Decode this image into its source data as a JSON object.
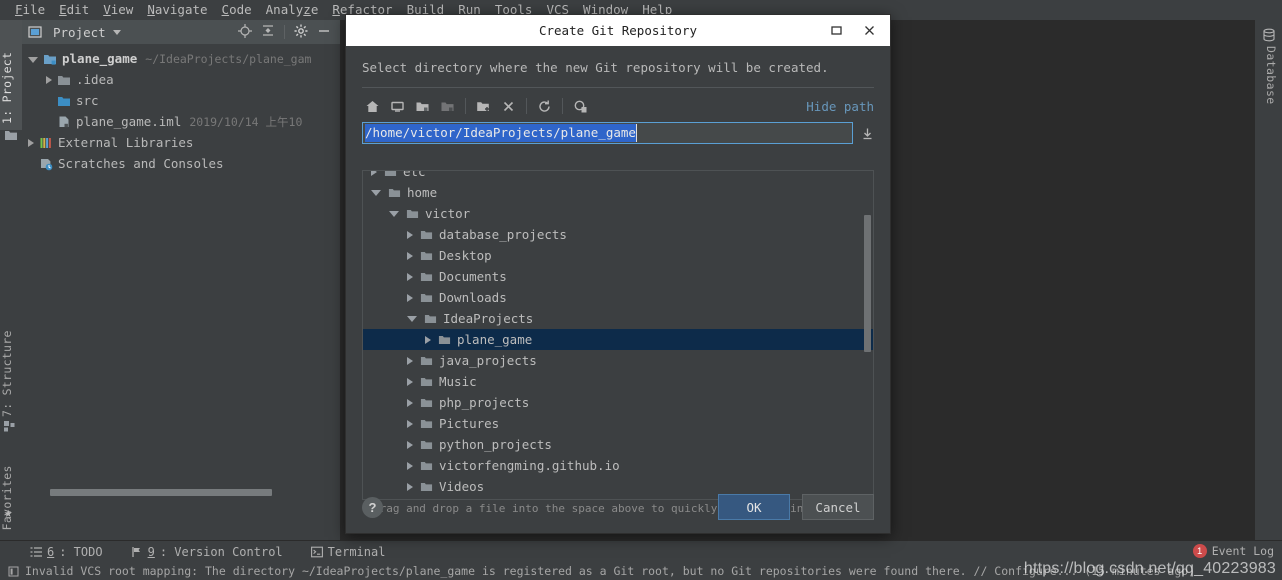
{
  "menubar": {
    "items": [
      {
        "label": "File",
        "accel": "F"
      },
      {
        "label": "Edit",
        "accel": "E"
      },
      {
        "label": "View",
        "accel": "V"
      },
      {
        "label": "Navigate",
        "accel": "N"
      },
      {
        "label": "Code",
        "accel": "C"
      },
      {
        "label": "Analyze",
        "accel": "z"
      },
      {
        "label": "Refactor",
        "accel": "R"
      },
      {
        "label": "Build",
        "accel": "B"
      },
      {
        "label": "Run",
        "accel": "R"
      },
      {
        "label": "Tools",
        "accel": "T"
      },
      {
        "label": "VCS",
        "accel": "S"
      },
      {
        "label": "Window",
        "accel": "W"
      },
      {
        "label": "Help",
        "accel": "H"
      }
    ]
  },
  "left_strip": {
    "tabs": [
      {
        "label": "1: Project",
        "num": "1",
        "rest": ": Project",
        "selected": true
      },
      {
        "label": "7: Structure",
        "num": "7",
        "rest": ": Structure",
        "selected": false
      },
      {
        "label": "2: Favorites",
        "num": "2",
        "rest": ": Favorites",
        "selected": false
      }
    ]
  },
  "right_strip": {
    "tabs": [
      {
        "label": "Database"
      }
    ]
  },
  "project_panel": {
    "title": "Project",
    "tree": [
      {
        "label": "plane_game",
        "sub": "~/IdeaProjects/plane_gam",
        "state": "open",
        "indent": 0,
        "icon": "module-icon",
        "bold": true
      },
      {
        "label": ".idea",
        "sub": "",
        "state": "closed",
        "indent": 1,
        "icon": "folder-icon",
        "bold": false
      },
      {
        "label": "src",
        "sub": "",
        "state": "leaf",
        "indent": 1,
        "icon": "source-folder-icon",
        "bold": false
      },
      {
        "label": "plane_game.iml",
        "sub": "2019/10/14 上午10",
        "state": "leaf",
        "indent": 1,
        "icon": "iml-file-icon",
        "bold": false
      },
      {
        "label": "External Libraries",
        "sub": "",
        "state": "closed",
        "indent": 0,
        "icon": "libraries-icon",
        "bold": false
      },
      {
        "label": "Scratches and Consoles",
        "sub": "",
        "state": "leaf",
        "indent": 0,
        "icon": "scratches-icon",
        "bold": false
      }
    ]
  },
  "dialog": {
    "title": "Create Git Repository",
    "description": "Select directory where the new Git repository will be created.",
    "hide_path_label": "Hide path",
    "path_value": "/home/victor/IdeaProjects/plane_game",
    "toolbar_icons": [
      "home-icon",
      "desktop-icon",
      "project-folder-icon",
      "module-folder-icon",
      "new-folder-icon",
      "delete-icon",
      "refresh-icon",
      "show-hidden-icon"
    ],
    "hint": "Drag and drop a file into the space above to quickly locate it in the tree",
    "help_label": "?",
    "ok_label": "OK",
    "cancel_label": "Cancel",
    "tree": [
      {
        "label": "etc",
        "state": "closed",
        "indent": 0,
        "selected": false,
        "clipped": true
      },
      {
        "label": "home",
        "state": "open",
        "indent": 0,
        "selected": false,
        "clipped": false
      },
      {
        "label": "victor",
        "state": "open",
        "indent": 1,
        "selected": false,
        "clipped": false
      },
      {
        "label": "database_projects",
        "state": "closed",
        "indent": 2,
        "selected": false,
        "clipped": false
      },
      {
        "label": "Desktop",
        "state": "closed",
        "indent": 2,
        "selected": false,
        "clipped": false
      },
      {
        "label": "Documents",
        "state": "closed",
        "indent": 2,
        "selected": false,
        "clipped": false
      },
      {
        "label": "Downloads",
        "state": "closed",
        "indent": 2,
        "selected": false,
        "clipped": false
      },
      {
        "label": "IdeaProjects",
        "state": "open",
        "indent": 2,
        "selected": false,
        "clipped": false
      },
      {
        "label": "plane_game",
        "state": "closed",
        "indent": 3,
        "selected": true,
        "clipped": false
      },
      {
        "label": "java_projects",
        "state": "closed",
        "indent": 2,
        "selected": false,
        "clipped": false
      },
      {
        "label": "Music",
        "state": "closed",
        "indent": 2,
        "selected": false,
        "clipped": false
      },
      {
        "label": "php_projects",
        "state": "closed",
        "indent": 2,
        "selected": false,
        "clipped": false
      },
      {
        "label": "Pictures",
        "state": "closed",
        "indent": 2,
        "selected": false,
        "clipped": false
      },
      {
        "label": "python_projects",
        "state": "closed",
        "indent": 2,
        "selected": false,
        "clipped": false
      },
      {
        "label": "victorfengming.github.io",
        "state": "closed",
        "indent": 2,
        "selected": false,
        "clipped": false
      },
      {
        "label": "Videos",
        "state": "closed",
        "indent": 2,
        "selected": false,
        "clipped": false
      }
    ]
  },
  "statusbar": {
    "tabs": [
      {
        "num": "6",
        "rest": ": TODO",
        "icon": "todo-icon"
      },
      {
        "num": "9",
        "rest": ": Version Control",
        "icon": "version-control-icon"
      },
      {
        "num": "",
        "rest": "Terminal",
        "icon": "terminal-icon"
      }
    ],
    "message": "Invalid VCS root mapping: The directory ~/IdeaProjects/plane_game is registered as a Git root, but no Git repositories were found there. // Configure... (15 minutes ago)",
    "event_log_label": "Event Log",
    "event_log_badge": "1",
    "watermark": "https://blog.csdn.net/qq_40223983"
  },
  "colors": {
    "accent_blue": "#6897bb",
    "selection_blue": "#2f65ca",
    "tree_selection": "#0d2b4a",
    "primary_button": "#365880",
    "panel_bg": "#3c3f41",
    "editor_bg": "#2b2b2b",
    "badge_red": "#cc4b4b"
  }
}
